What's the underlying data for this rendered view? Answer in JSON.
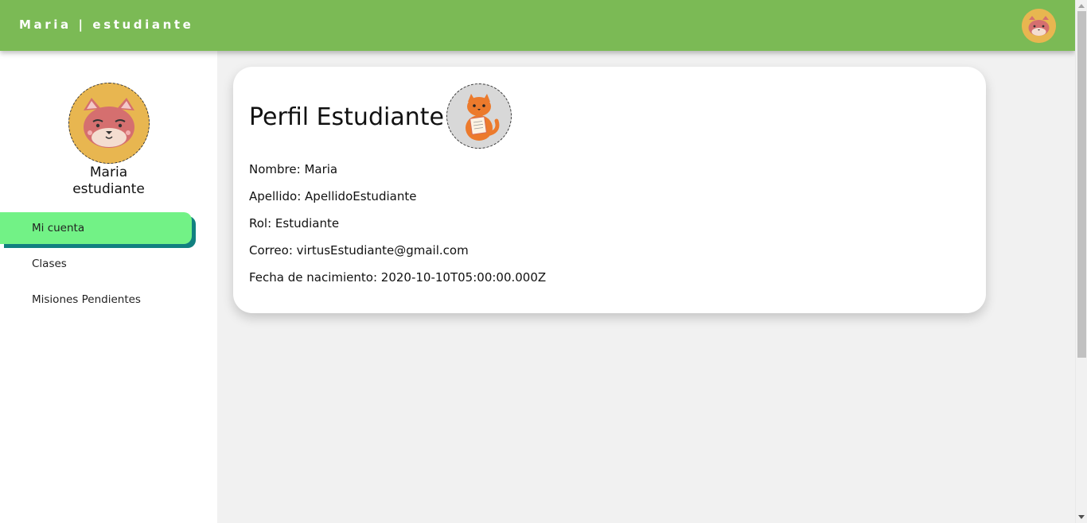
{
  "header": {
    "brand": "Maria | estudiante",
    "avatar_icon": "cat-face-icon",
    "color": "#7bba55"
  },
  "sidebar": {
    "avatar_icon": "cat-face-icon",
    "name": "Maria",
    "role": "estudiante",
    "items": [
      {
        "label": "Mi cuenta",
        "active": true
      },
      {
        "label": "Clases",
        "active": false
      },
      {
        "label": "Misiones Pendientes",
        "active": false
      }
    ],
    "active_color": "#72f286",
    "active_shadow_color": "#118080"
  },
  "profile": {
    "title": "Perfil Estudiante",
    "avatar_icon": "cat-reading-icon",
    "fields": [
      {
        "label": "Nombre",
        "value": "Maria"
      },
      {
        "label": "Apellido",
        "value": "ApellidoEstudiante"
      },
      {
        "label": "Rol",
        "value": "Estudiante"
      },
      {
        "label": "Correo",
        "value": "virtusEstudiante@gmail.com"
      },
      {
        "label": "Fecha de nacimiento",
        "value": "2020-10-10T05:00:00.000Z"
      }
    ]
  }
}
